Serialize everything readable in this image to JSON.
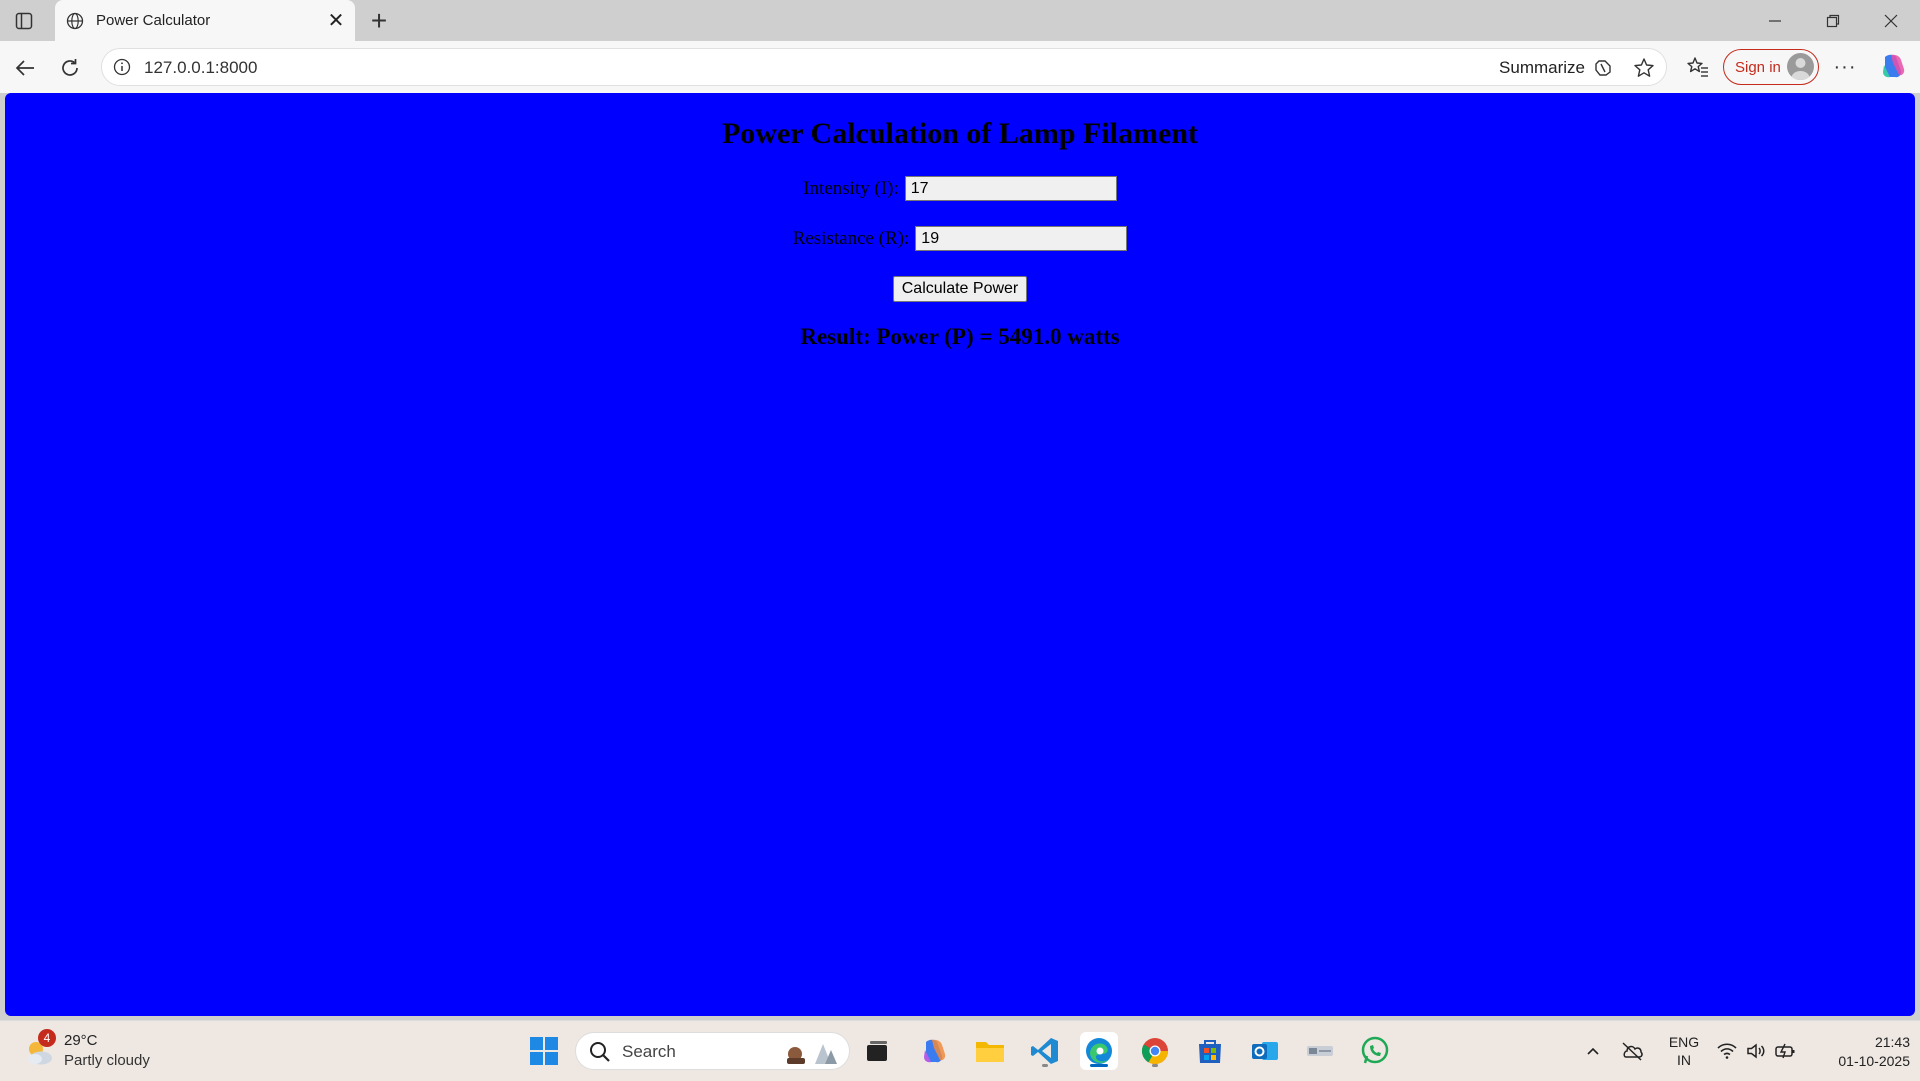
{
  "browser": {
    "tab_title": "Power Calculator",
    "url": "127.0.0.1:8000",
    "summarize_label": "Summarize",
    "signin_label": "Sign in"
  },
  "page": {
    "heading": "Power Calculation of Lamp Filament",
    "intensity_label": "Intensity (I):",
    "intensity_value": "17",
    "resistance_label": "Resistance (R):",
    "resistance_value": "19",
    "button_label": "Calculate Power",
    "result_text": "Result: Power (P) = 5491.0 watts",
    "background_color": "#0000ff"
  },
  "taskbar": {
    "weather_badge": "4",
    "weather_temp": "29°C",
    "weather_condition": "Partly cloudy",
    "search_label": "Search",
    "lang_line1": "ENG",
    "lang_line2": "IN",
    "time": "21:43",
    "date": "01-10-2025"
  }
}
